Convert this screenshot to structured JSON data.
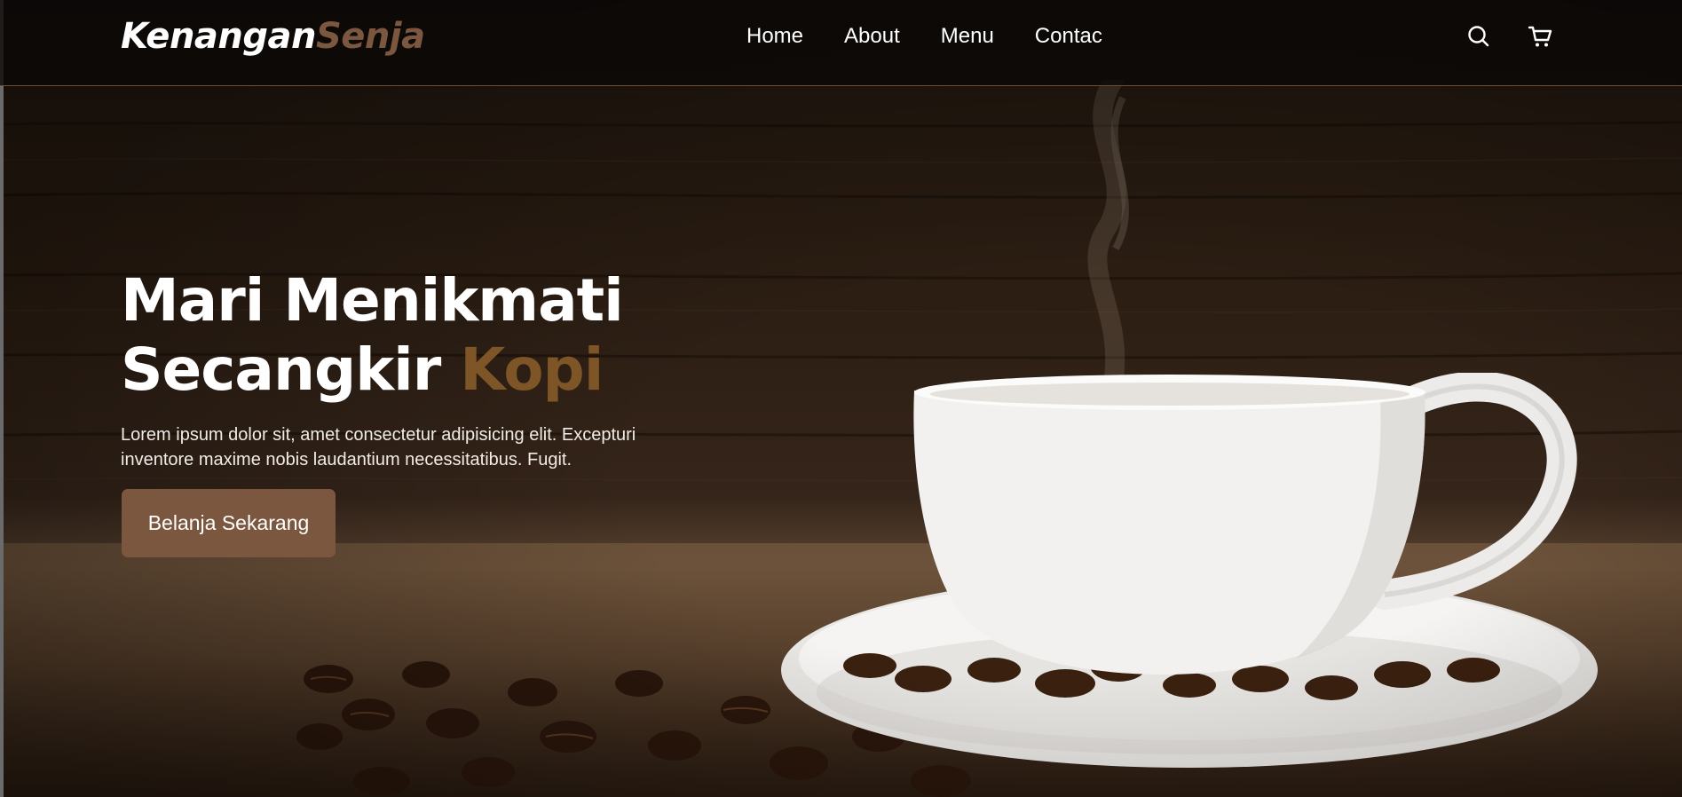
{
  "brand": {
    "name_primary": "Kenangan",
    "name_accent": "Senja"
  },
  "nav": {
    "links": [
      "Home",
      "About",
      "Menu",
      "Contac"
    ],
    "icons": [
      "search-icon",
      "cart-icon"
    ]
  },
  "hero": {
    "title_line1": "Mari Menikmati",
    "title_line2_plain": "Secangkir ",
    "title_line2_accent": "Kopi",
    "description": "Lorem ipsum dolor sit, amet consectetur adipisicing elit. Excepturi inventore maxime nobis laudantium necessitatibus. Fugit.",
    "cta_label": "Belanja Sekarang"
  },
  "colors": {
    "accent_brown": "#7b573f",
    "kopi_brown": "#7d5526",
    "navbar_bg": "#0a0806",
    "text": "#ffffff"
  }
}
